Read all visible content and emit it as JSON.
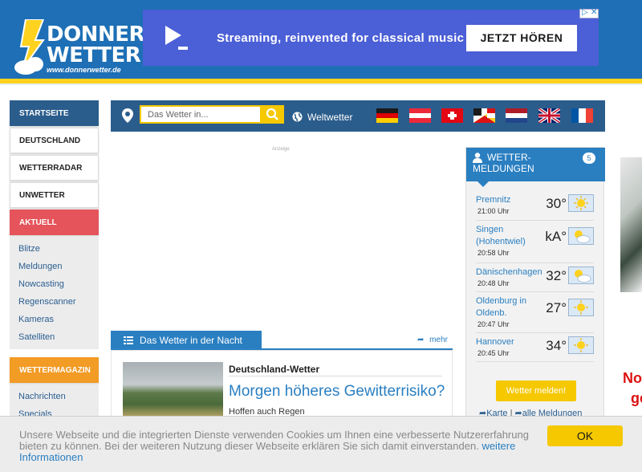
{
  "logo": {
    "line1": "DONNER",
    "line2": "WETTER",
    "url": "www.donnerwetter.de"
  },
  "ad": {
    "text": "Streaming, reinvented for classical music",
    "cta": "JETZT HÖREN"
  },
  "nav": {
    "startseite": "STARTSEITE",
    "deutschland": "DEUTSCHLAND",
    "wetterradar": "WETTERRADAR",
    "unwetter": "UNWETTER",
    "aktuell": "AKTUELL",
    "aktuell_items": [
      "Blitze",
      "Meldungen",
      "Nowcasting",
      "Regenscanner",
      "Kameras",
      "Satelliten"
    ],
    "wettermagazin": "WETTERMAGAZIN",
    "magazin_items": [
      "Nachrichten",
      "Specials"
    ]
  },
  "search": {
    "placeholder": "Das Wetter in...",
    "weltwetter": "Weltwetter"
  },
  "anzeige": "Anzeige",
  "night": {
    "tab": "Das Wetter in der Nacht",
    "mehr": "mehr",
    "kicker": "Deutschland-Wetter",
    "headline": "Morgen höheres Gewitterrisiko?",
    "sub": "Hoffen auch Regen"
  },
  "reports": {
    "title1": "WETTER-",
    "title2": "MELDUNGEN",
    "count": "5",
    "items": [
      {
        "city": "Premnitz",
        "time": "21:00 Uhr",
        "temp": "30°",
        "icon": "sun-icon"
      },
      {
        "city": "Singen (Hohentwiel)",
        "time": "20:58 Uhr",
        "temp": "kA°",
        "icon": "sun-cloud-icon"
      },
      {
        "city": "Dänischenhagen",
        "time": "20:48 Uhr",
        "temp": "32°",
        "icon": "sun-cloud-icon"
      },
      {
        "city": "Oldenburg in Oldenb.",
        "time": "20:47 Uhr",
        "temp": "27°",
        "icon": "sun-icon"
      },
      {
        "city": "Hannover",
        "time": "20:45 Uhr",
        "temp": "34°",
        "icon": "sun-icon"
      }
    ],
    "button": "Wetter melden!",
    "link_karte": "Karte",
    "link_alle": "alle Meldungen"
  },
  "right_ad": {
    "line1": "No",
    "line2": "ge"
  },
  "cookie": {
    "text": "Unsere Webseite und die integrierten Dienste verwenden Cookies um Ihnen eine verbesserte Nutzererfahrung bieten zu können. Bei der weiteren Nutzung dieser Webseite erklären Sie sich damit einverstanden.",
    "link": "weitere Informationen",
    "ok": "OK"
  },
  "colors": {
    "primary": "#2a7fc1",
    "dark_blue": "#2b5d8c",
    "header": "#1e6fb5",
    "yellow": "#f5c800",
    "red": "#e5545b",
    "orange": "#f29b25"
  }
}
